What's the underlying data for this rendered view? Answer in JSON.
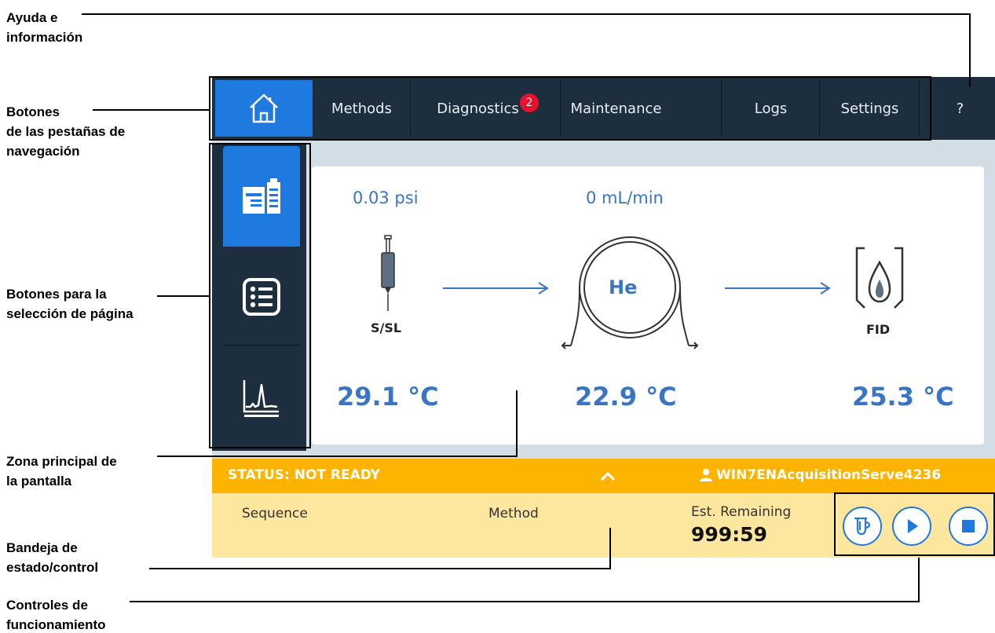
{
  "callouts": {
    "help": "Ayuda e\ninformación",
    "tabs": "Botones\nde las pestañas de\nnavegación",
    "page_select": "Botones para la\nselección de página",
    "main_area": "Zona principal de\nla pantalla",
    "tray": "Bandeja de\nestado/control",
    "controls": "Controles de\nfuncionamiento"
  },
  "nav": {
    "tabs": [
      {
        "label": "Methods"
      },
      {
        "label": "Diagnostics",
        "badge": "2"
      },
      {
        "label": "Maintenance"
      },
      {
        "label": "Logs"
      },
      {
        "label": "Settings"
      },
      {
        "label": "?"
      }
    ],
    "home_icon": "home-icon"
  },
  "sidebar": {
    "icons": [
      "instrument-icon",
      "list-icon",
      "chromatogram-icon"
    ]
  },
  "main": {
    "pressure": "0.03 psi",
    "flow": "0 mL/min",
    "inlet_label": "S/SL",
    "column_label": "He",
    "detector_label": "FID",
    "inlet_temp": "29.1 °C",
    "oven_temp": "22.9 °C",
    "detector_temp": "25.3 °C"
  },
  "status": {
    "text": "STATUS: NOT READY",
    "toggle_icon": "chevron-up-icon",
    "user": "WIN7ENAcquisitionServe4236",
    "user_icon": "user-icon"
  },
  "tray": {
    "sequence_label": "Sequence",
    "method_label": "Method",
    "est_remaining_label": "Est. Remaining",
    "est_remaining_value": "999:59",
    "buttons": [
      "prep-run-icon",
      "start-icon",
      "stop-icon"
    ]
  },
  "colors": {
    "nav_bg": "#1d2e3e",
    "accent_blue": "#1f7ae0",
    "value_blue": "#3a74c4",
    "status_orange": "#fcb400",
    "tray_yellow": "#fde69e",
    "badge_red": "#e8102a"
  }
}
